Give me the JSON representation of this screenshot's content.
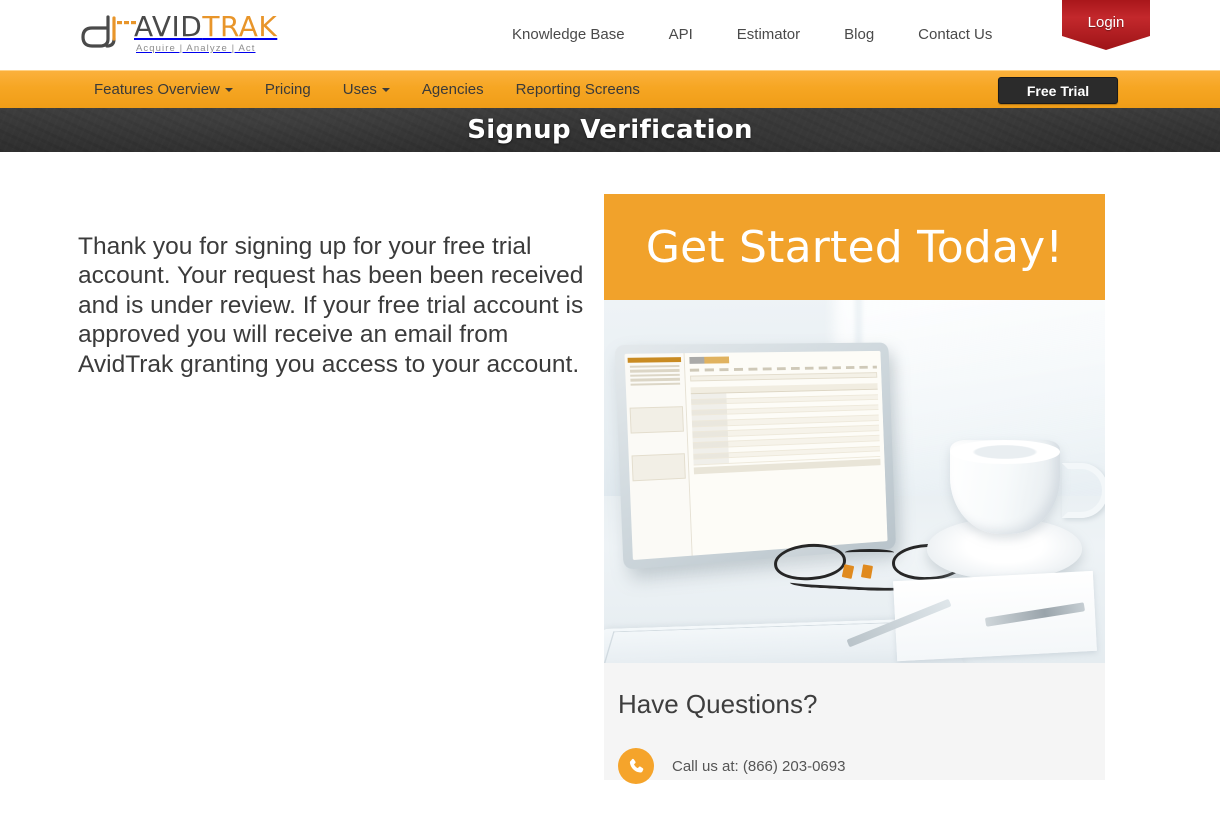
{
  "header": {
    "logo": {
      "word_primary": "AVID",
      "word_secondary": "TRAK",
      "tagline": "Acquire  |  Analyze  |  Act"
    },
    "top_nav": [
      {
        "label": "Knowledge Base"
      },
      {
        "label": "API"
      },
      {
        "label": "Estimator"
      },
      {
        "label": "Blog"
      },
      {
        "label": "Contact Us"
      }
    ],
    "login_label": "Login"
  },
  "menubar": {
    "items": [
      {
        "label": "Features Overview",
        "has_caret": true
      },
      {
        "label": "Pricing",
        "has_caret": false
      },
      {
        "label": "Uses",
        "has_caret": true
      },
      {
        "label": "Agencies",
        "has_caret": false
      },
      {
        "label": "Reporting Screens",
        "has_caret": false
      }
    ],
    "free_trial_label": "Free Trial"
  },
  "page_title": "Signup Verification",
  "main": {
    "body_copy": "Thank you for signing up for your free trial account. Your request has been been received and is under review. If your free trial account is approved you will receive an email from AvidTrak granting you access to your account."
  },
  "promo": {
    "banner_heading": "Get Started Today!",
    "image_alt": "tablet-dashboard-desk-photo",
    "questions_heading": "Have Questions?",
    "phone_text": "Call us at: (866) 203-0693"
  },
  "colors": {
    "brand_orange": "#F5A42B",
    "menubar_orange": "#F6A623",
    "promo_orange": "#F1A22B",
    "login_red": "#C3282C",
    "dark_banner": "#343434",
    "panel_gray": "#F5F5F5",
    "logo_dark": "#4A4A4A"
  }
}
